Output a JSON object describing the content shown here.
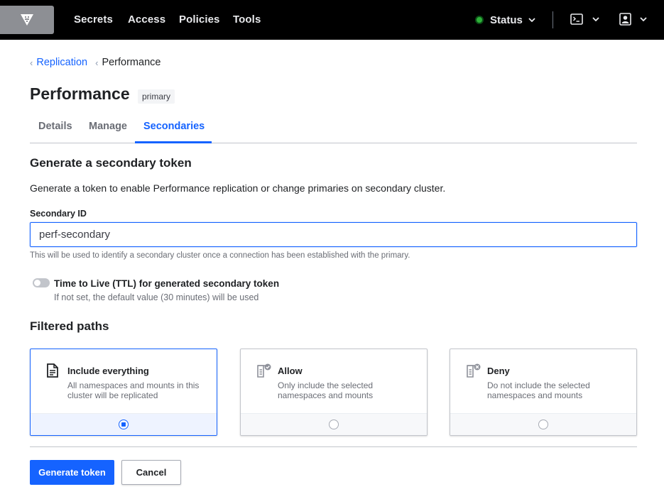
{
  "nav": {
    "logo_icon": "vault-logo-icon",
    "links": [
      "Secrets",
      "Access",
      "Policies",
      "Tools"
    ],
    "status_label": "Status",
    "status_color": "#2eb039",
    "console_icon": "terminal-icon",
    "user_icon": "user-icon"
  },
  "breadcrumb": {
    "parent": "Replication",
    "current": "Performance"
  },
  "page": {
    "title": "Performance",
    "badge": "primary"
  },
  "tabs": [
    "Details",
    "Manage",
    "Secondaries"
  ],
  "active_tab": "Secondaries",
  "form": {
    "section_title": "Generate a secondary token",
    "description": "Generate a token to enable Performance replication or change primaries on secondary cluster.",
    "secondary_id_label": "Secondary ID",
    "secondary_id_value": "perf-secondary",
    "secondary_id_help": "This will be used to identify a secondary cluster once a connection has been established with the primary.",
    "ttl_label": "Time to Live (TTL) for generated secondary token",
    "ttl_help": "If not set, the default value (30 minutes) will be used",
    "ttl_enabled": false,
    "filtered_title": "Filtered paths",
    "options": [
      {
        "title": "Include everything",
        "desc": "All namespaces and mounts in this cluster will be replicated",
        "icon": "file-text-icon",
        "selected": true
      },
      {
        "title": "Allow",
        "desc": "Only include the selected namespaces and mounts",
        "icon": "file-check-icon",
        "selected": false
      },
      {
        "title": "Deny",
        "desc": "Do not include the selected namespaces and mounts",
        "icon": "file-x-icon",
        "selected": false
      }
    ],
    "submit_label": "Generate token",
    "cancel_label": "Cancel"
  },
  "colors": {
    "accent": "#1563ff",
    "nav_bg": "#000000"
  }
}
